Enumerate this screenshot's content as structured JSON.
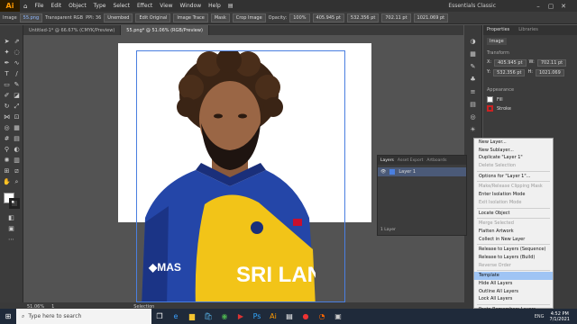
{
  "menubar": {
    "logo": "Ai",
    "items": [
      "File",
      "Edit",
      "Object",
      "Type",
      "Select",
      "Effect",
      "View",
      "Window",
      "Help"
    ],
    "workspace": "Essentials Classic"
  },
  "ctrlbar": {
    "image": "Image",
    "file": "55.png",
    "transparent": "Transparent RGB",
    "ppi": "PPI: 36",
    "embed": "Unembed",
    "edit": "Edit Original",
    "trace": "Image Trace",
    "mask": "Mask",
    "crop": "Crop Image",
    "opacity_label": "Opacity:",
    "opacity": "100%",
    "x": "405.945 pt",
    "y": "532.356 pt",
    "w": "702.11 pt",
    "h": "1021.069 pt"
  },
  "tabs": [
    {
      "label": "Untitled-1* @ 66.67% (CMYK/Preview)"
    },
    {
      "label": "55.png* @ 51.06% (RGB/Preview)"
    }
  ],
  "properties": {
    "tab1": "Properties",
    "tab2": "Libraries",
    "section": "Image",
    "transform": "Transform",
    "x_label": "X:",
    "x": "405.945 pt",
    "y_label": "Y:",
    "y": "532.356 pt",
    "w_label": "W:",
    "w": "702.11 pt",
    "h_label": "H:",
    "h": "1021.069",
    "appearance": "Appearance",
    "fill": "Fill",
    "stroke": "Stroke"
  },
  "layers": {
    "tab1": "Layers",
    "tab2": "Asset Export",
    "tab3": "Artboards",
    "layer_name": "Layer 1",
    "footer": "1 Layer"
  },
  "context_menu": [
    {
      "label": "New Layer...",
      "state": "normal"
    },
    {
      "label": "New Sublayer...",
      "state": "normal"
    },
    {
      "label": "Duplicate \"Layer 1\"",
      "state": "normal"
    },
    {
      "label": "Delete Selection",
      "state": "disabled"
    },
    {
      "sep": true
    },
    {
      "label": "Options for \"Layer 1\"...",
      "state": "normal"
    },
    {
      "sep": true
    },
    {
      "label": "Make/Release Clipping Mask",
      "state": "disabled"
    },
    {
      "label": "Enter Isolation Mode",
      "state": "normal"
    },
    {
      "label": "Exit Isolation Mode",
      "state": "disabled"
    },
    {
      "sep": true
    },
    {
      "label": "Locate Object",
      "state": "normal"
    },
    {
      "sep": true
    },
    {
      "label": "Merge Selected",
      "state": "disabled"
    },
    {
      "label": "Flatten Artwork",
      "state": "normal"
    },
    {
      "label": "Collect in New Layer",
      "state": "normal"
    },
    {
      "sep": true
    },
    {
      "label": "Release to Layers (Sequence)",
      "state": "normal"
    },
    {
      "label": "Release to Layers (Build)",
      "state": "normal"
    },
    {
      "label": "Reverse Order",
      "state": "disabled"
    },
    {
      "sep": true
    },
    {
      "label": "Template",
      "state": "highlight"
    },
    {
      "label": "Hide All Layers",
      "state": "normal"
    },
    {
      "label": "Outline All Layers",
      "state": "normal"
    },
    {
      "label": "Lock All Layers",
      "state": "normal"
    },
    {
      "sep": true
    },
    {
      "label": "Paste Remembers Layers",
      "state": "normal"
    },
    {
      "sep": true
    },
    {
      "label": "Panel Options...",
      "state": "normal"
    }
  ],
  "status": {
    "zoom": "51.06%",
    "page": "1",
    "tool": "Selection"
  },
  "taskbar": {
    "search": "Type here to search",
    "lang": "ENG",
    "time": "4:52 PM",
    "date": "7/1/2021"
  },
  "colors": {
    "accent": "#4a7fe0",
    "highlight": "#9fc4f4",
    "ai_orange": "#ff9a00"
  }
}
